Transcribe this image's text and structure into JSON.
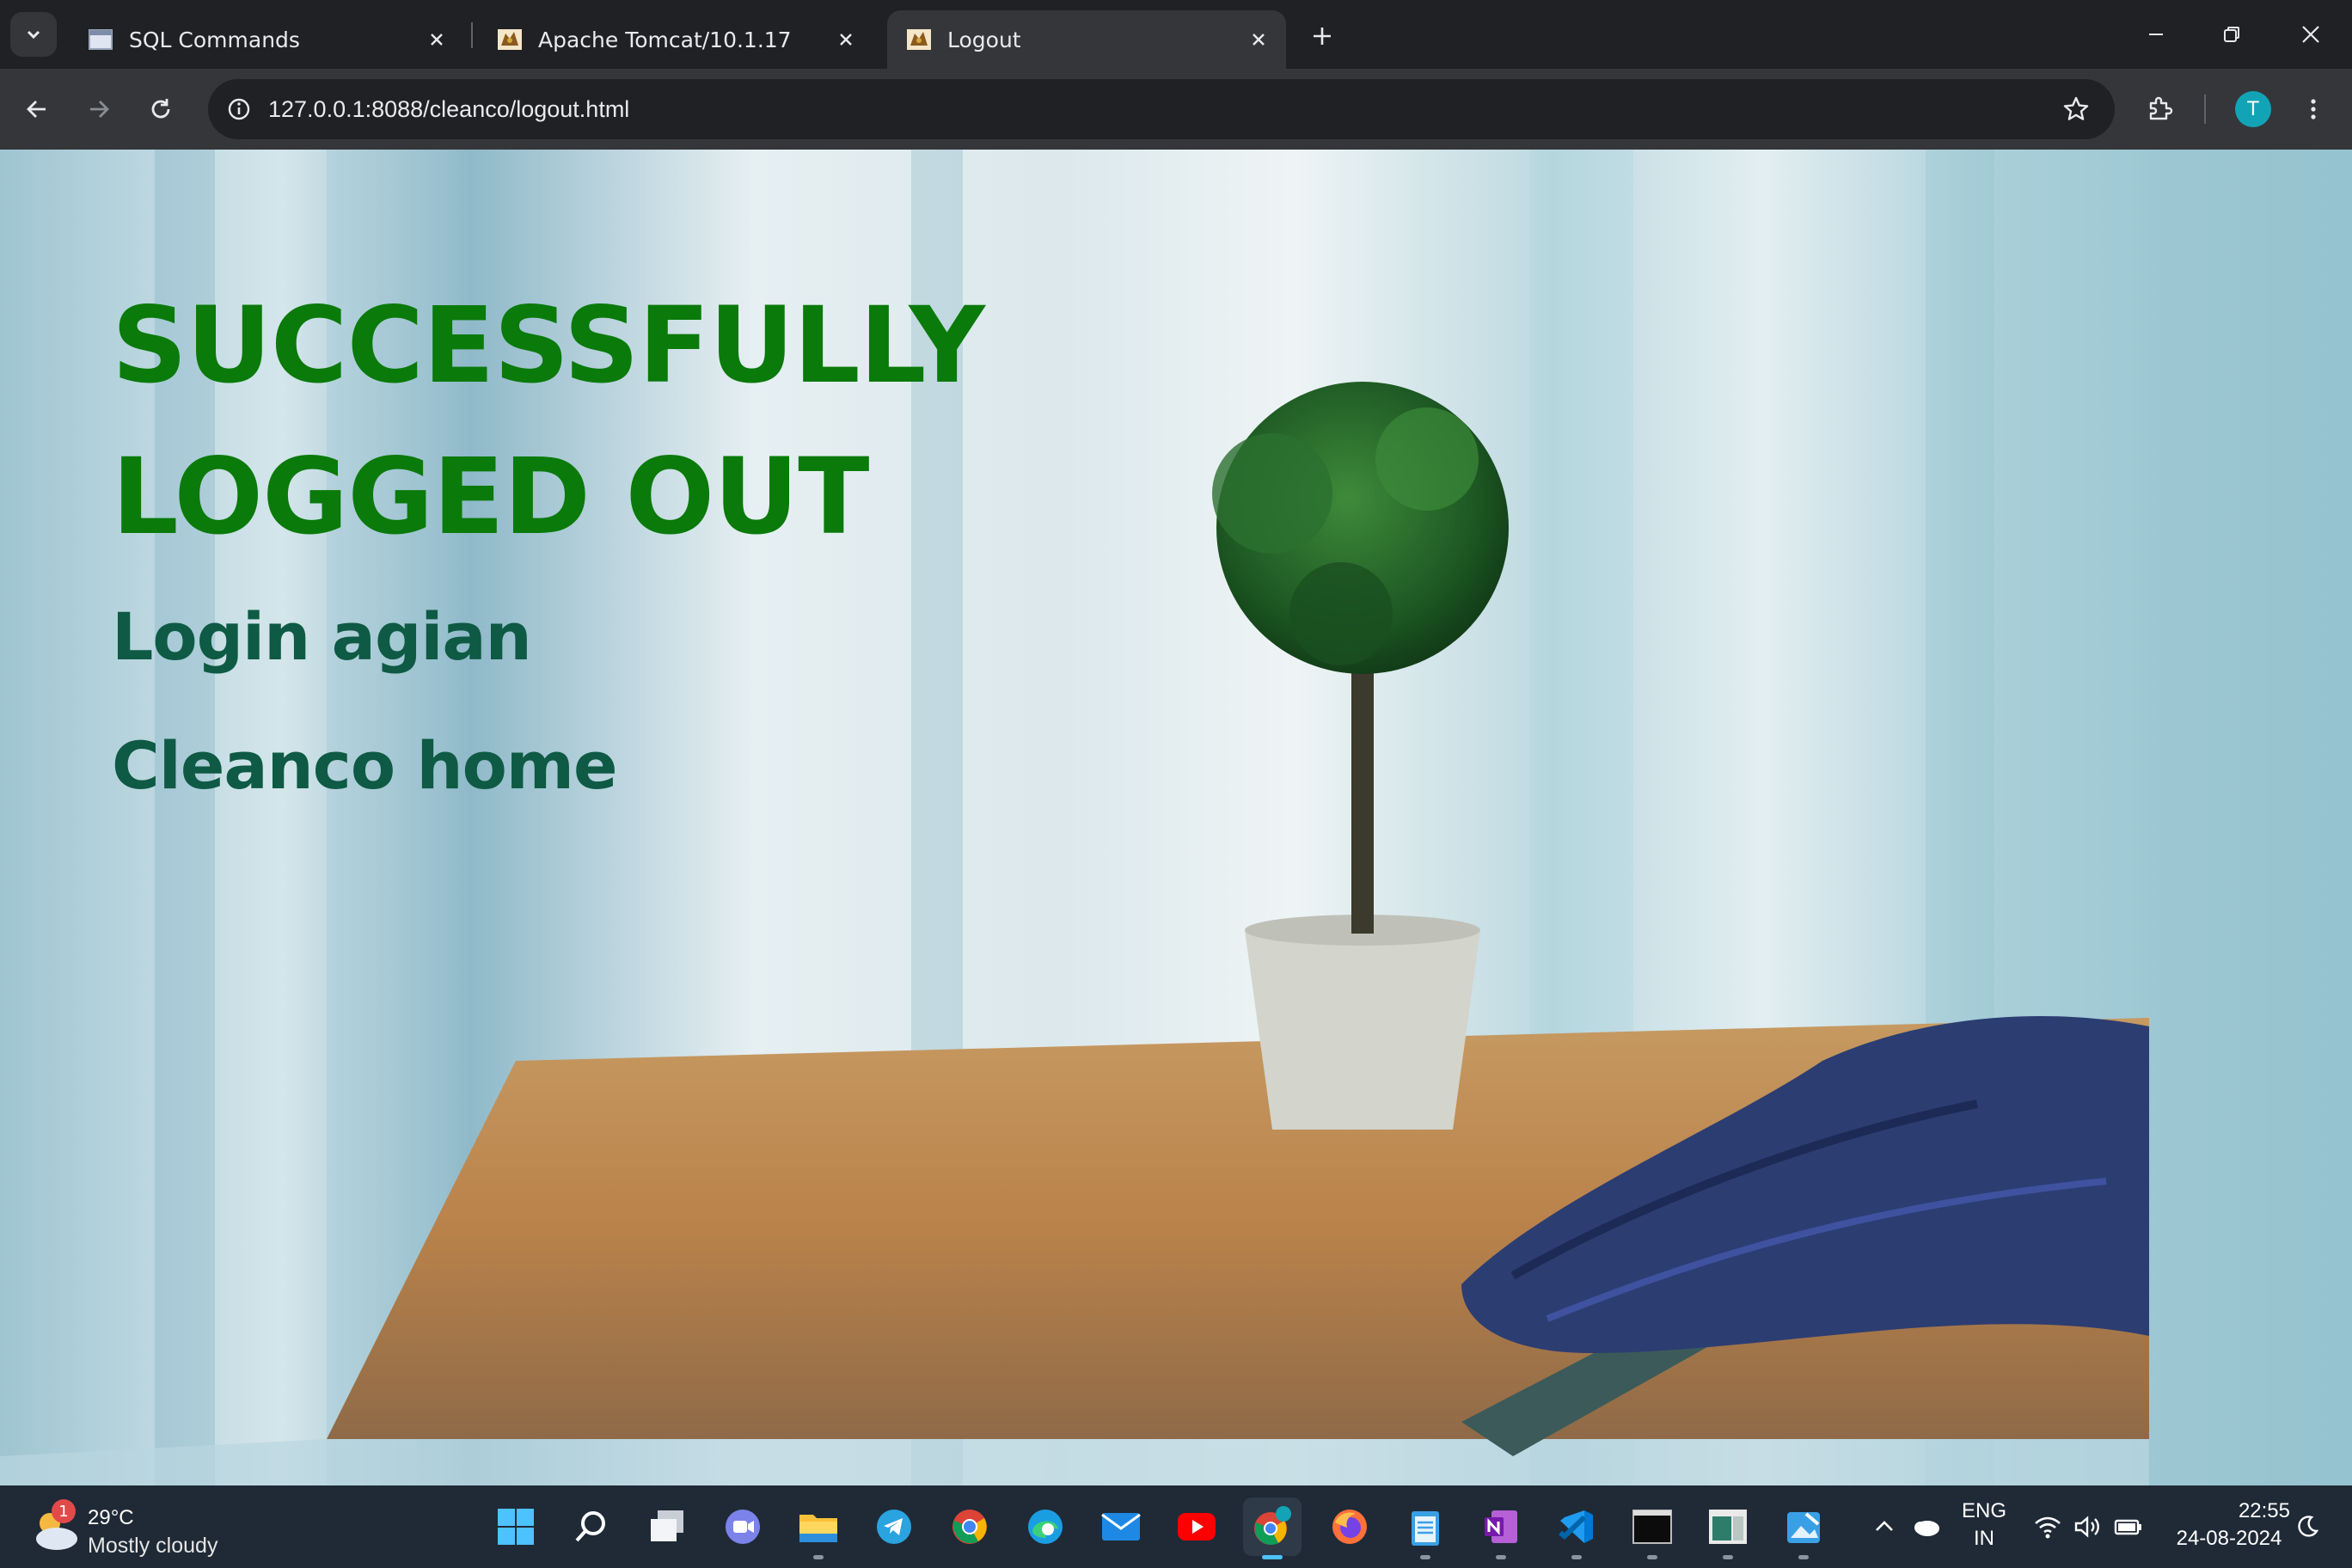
{
  "browser": {
    "tabs": [
      {
        "title": "SQL Commands",
        "favicon": "window-icon",
        "active": false
      },
      {
        "title": "Apache Tomcat/10.1.17",
        "favicon": "tomcat-icon",
        "active": false
      },
      {
        "title": "Logout",
        "favicon": "tomcat-icon",
        "active": true
      }
    ],
    "url": "127.0.0.1:8088/cleanco/logout.html",
    "profile_initial": "T"
  },
  "page": {
    "headline_line1": "SUCCESSFULLY",
    "headline_line2": "LOGGED OUT",
    "links": [
      "Login agian",
      "Cleanco home"
    ],
    "colors": {
      "headline": "#0a7a0a",
      "links": "#0e5a44"
    }
  },
  "taskbar": {
    "weather": {
      "temp": "29°C",
      "condition": "Mostly cloudy",
      "badge": "1"
    },
    "apps": [
      "start-icon",
      "search-icon",
      "task-view-icon",
      "teams-icon",
      "file-explorer-icon",
      "telegram-icon",
      "chrome-icon",
      "edge-icon",
      "mail-icon",
      "youtube-icon",
      "chrome-profile-icon",
      "firefox-icon",
      "notepad-icon",
      "onenote-icon",
      "vscode-icon",
      "terminal-icon",
      "app-icon",
      "paint-icon"
    ],
    "language": "ENG",
    "region": "IN",
    "time": "22:55",
    "date": "24-08-2024"
  }
}
